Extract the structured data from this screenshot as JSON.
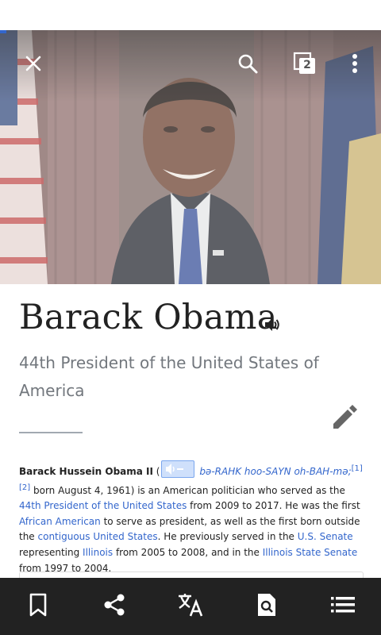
{
  "article": {
    "title": "Barack Obama",
    "description": "44th President of the United States of America"
  },
  "toolbar": {
    "tabs_count": "2"
  },
  "lead": {
    "name_bold": "Barack Hussein Obama II",
    "open_paren": " (",
    "ipa": "bə-RAHK hoo-SAYN oh-BAH-mə;",
    "ref1": "[1]",
    "ref2": "[2]",
    "t1": " born August 4, 1961) is an American politician who served as the ",
    "link_44th": "44th President of the United States",
    "t2": " from 2009 to 2017. He was the first ",
    "link_aa": "African American",
    "t3": " to serve as president, as well as the first born outside the ",
    "link_cus": "contiguous United States",
    "t4": ". He previously served in the ",
    "link_senate": "U.S. Senate",
    "t5": " representing ",
    "link_illinois": "Illinois",
    "t6": " from 2005 to 2008, and in the ",
    "link_iss": "Illinois State Senate",
    "t7": " from 1997 to 2004."
  },
  "colors": {
    "link": "#3366cc",
    "bottom_bar": "#222222"
  },
  "icons": {
    "close": "close-icon",
    "search": "search-icon",
    "tabs": "tabs-icon",
    "overflow": "more-vert-icon",
    "speaker": "speaker-icon",
    "edit": "pencil-icon",
    "bookmark": "bookmark-icon",
    "share": "share-icon",
    "translate": "translate-icon",
    "find": "find-in-page-icon",
    "contents": "contents-list-icon"
  }
}
